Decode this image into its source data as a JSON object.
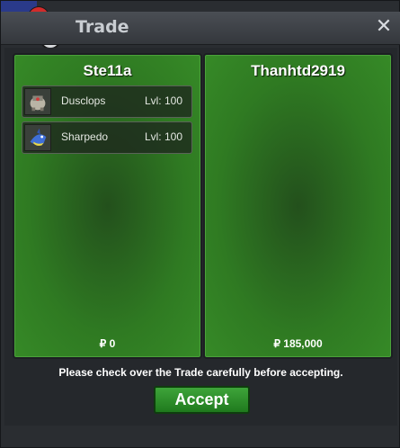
{
  "window": {
    "title": "Trade",
    "close_label": "✕"
  },
  "left_panel": {
    "player": "Ste11a",
    "items": [
      {
        "name": "Dusclops",
        "level": "Lvl: 100",
        "icon": "dusclops-sprite-icon"
      },
      {
        "name": "Sharpedo",
        "level": "Lvl: 100",
        "icon": "sharpedo-sprite-icon"
      }
    ],
    "money": "₽ 0"
  },
  "right_panel": {
    "player": "Thanhtd2919",
    "items": [],
    "money": "₽ 185,000"
  },
  "footer": {
    "notice": "Please check over the Trade carefully before accepting.",
    "accept_label": "Accept"
  },
  "colors": {
    "panel_green": "#2f7a22",
    "accept_green": "#2f8f2c",
    "background": "#2a2d31"
  }
}
